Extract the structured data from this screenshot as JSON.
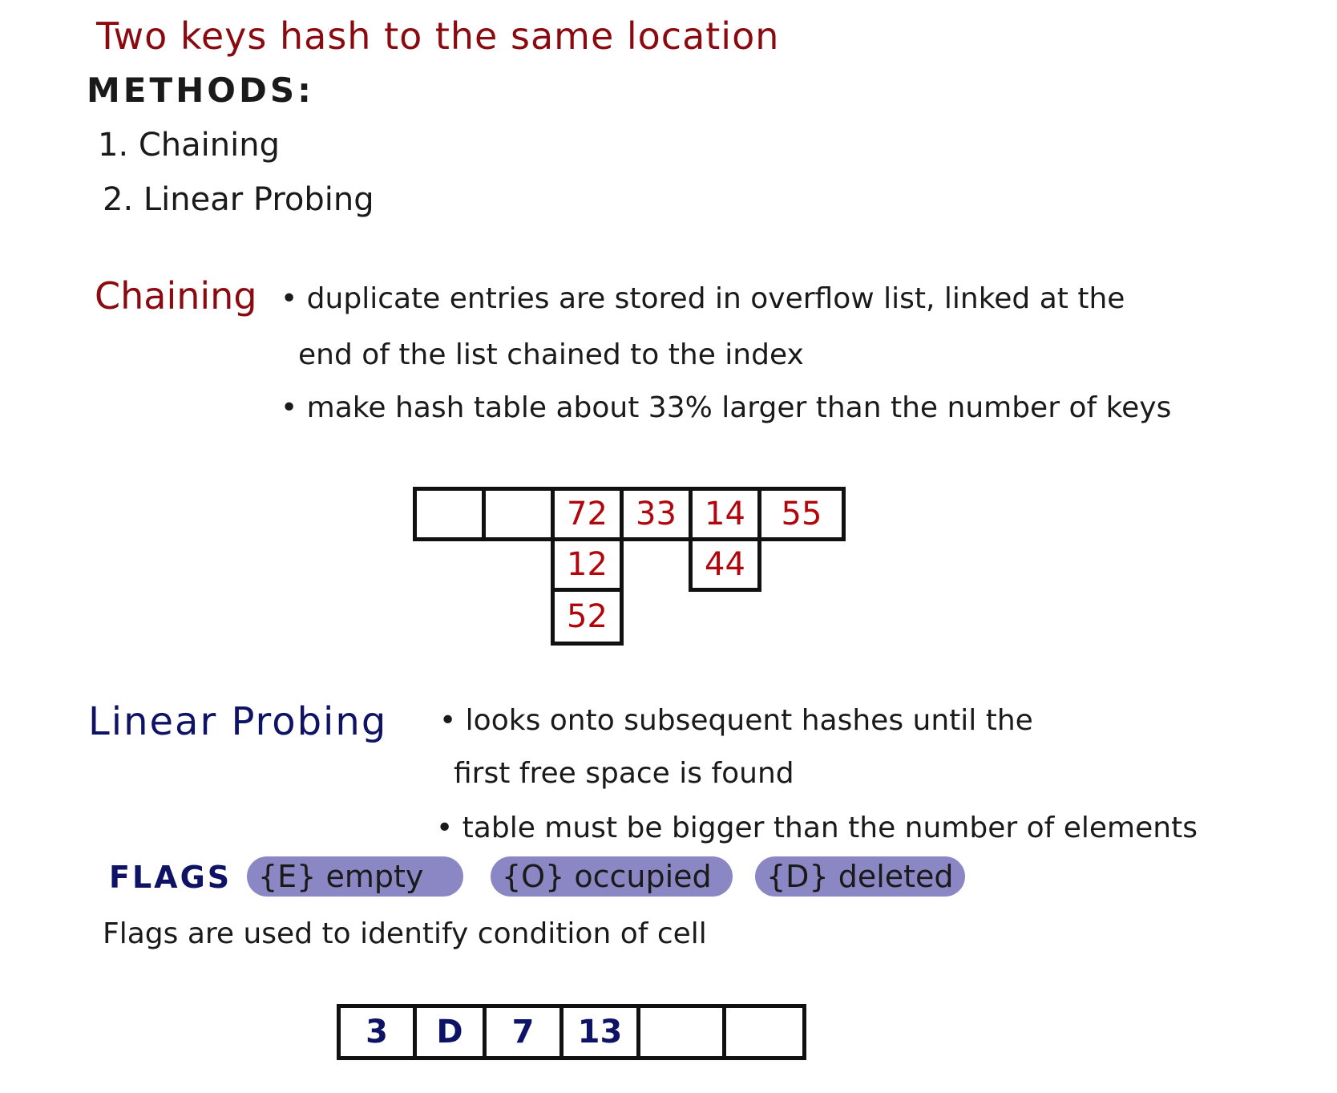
{
  "title": "Two keys hash to the same location",
  "methods": {
    "heading": "METHODS:",
    "items": [
      "1. Chaining",
      "2. Linear Probing"
    ]
  },
  "chaining": {
    "heading": "Chaining",
    "bullet1": "• duplicate entries are stored in overflow list, linked at the",
    "bullet1_cont": "end of the list chained to the index",
    "bullet2": "• make hash table about 33% larger than the number of keys",
    "table_top": [
      "",
      "",
      "72",
      "33",
      "14",
      "55"
    ],
    "chain_col2": [
      "12",
      "52"
    ],
    "chain_col4": [
      "44"
    ]
  },
  "linear_probing": {
    "heading": "Linear Probing",
    "bullet1": "• looks onto subsequent hashes until the",
    "bullet1_cont": "first free space is found",
    "bullet2": "• table must be bigger than the number of elements"
  },
  "flags": {
    "heading": "FLAGS",
    "items": [
      "{E} empty",
      "{O} occupied",
      "{D} deleted"
    ],
    "description": "Flags are used to identify condition of cell",
    "table": [
      "3",
      "D",
      "7",
      "13",
      "",
      ""
    ]
  },
  "colors": {
    "red_ink": "#8b0a0f",
    "blue_ink": "#0f1366",
    "highlight": "#8a87c4"
  }
}
